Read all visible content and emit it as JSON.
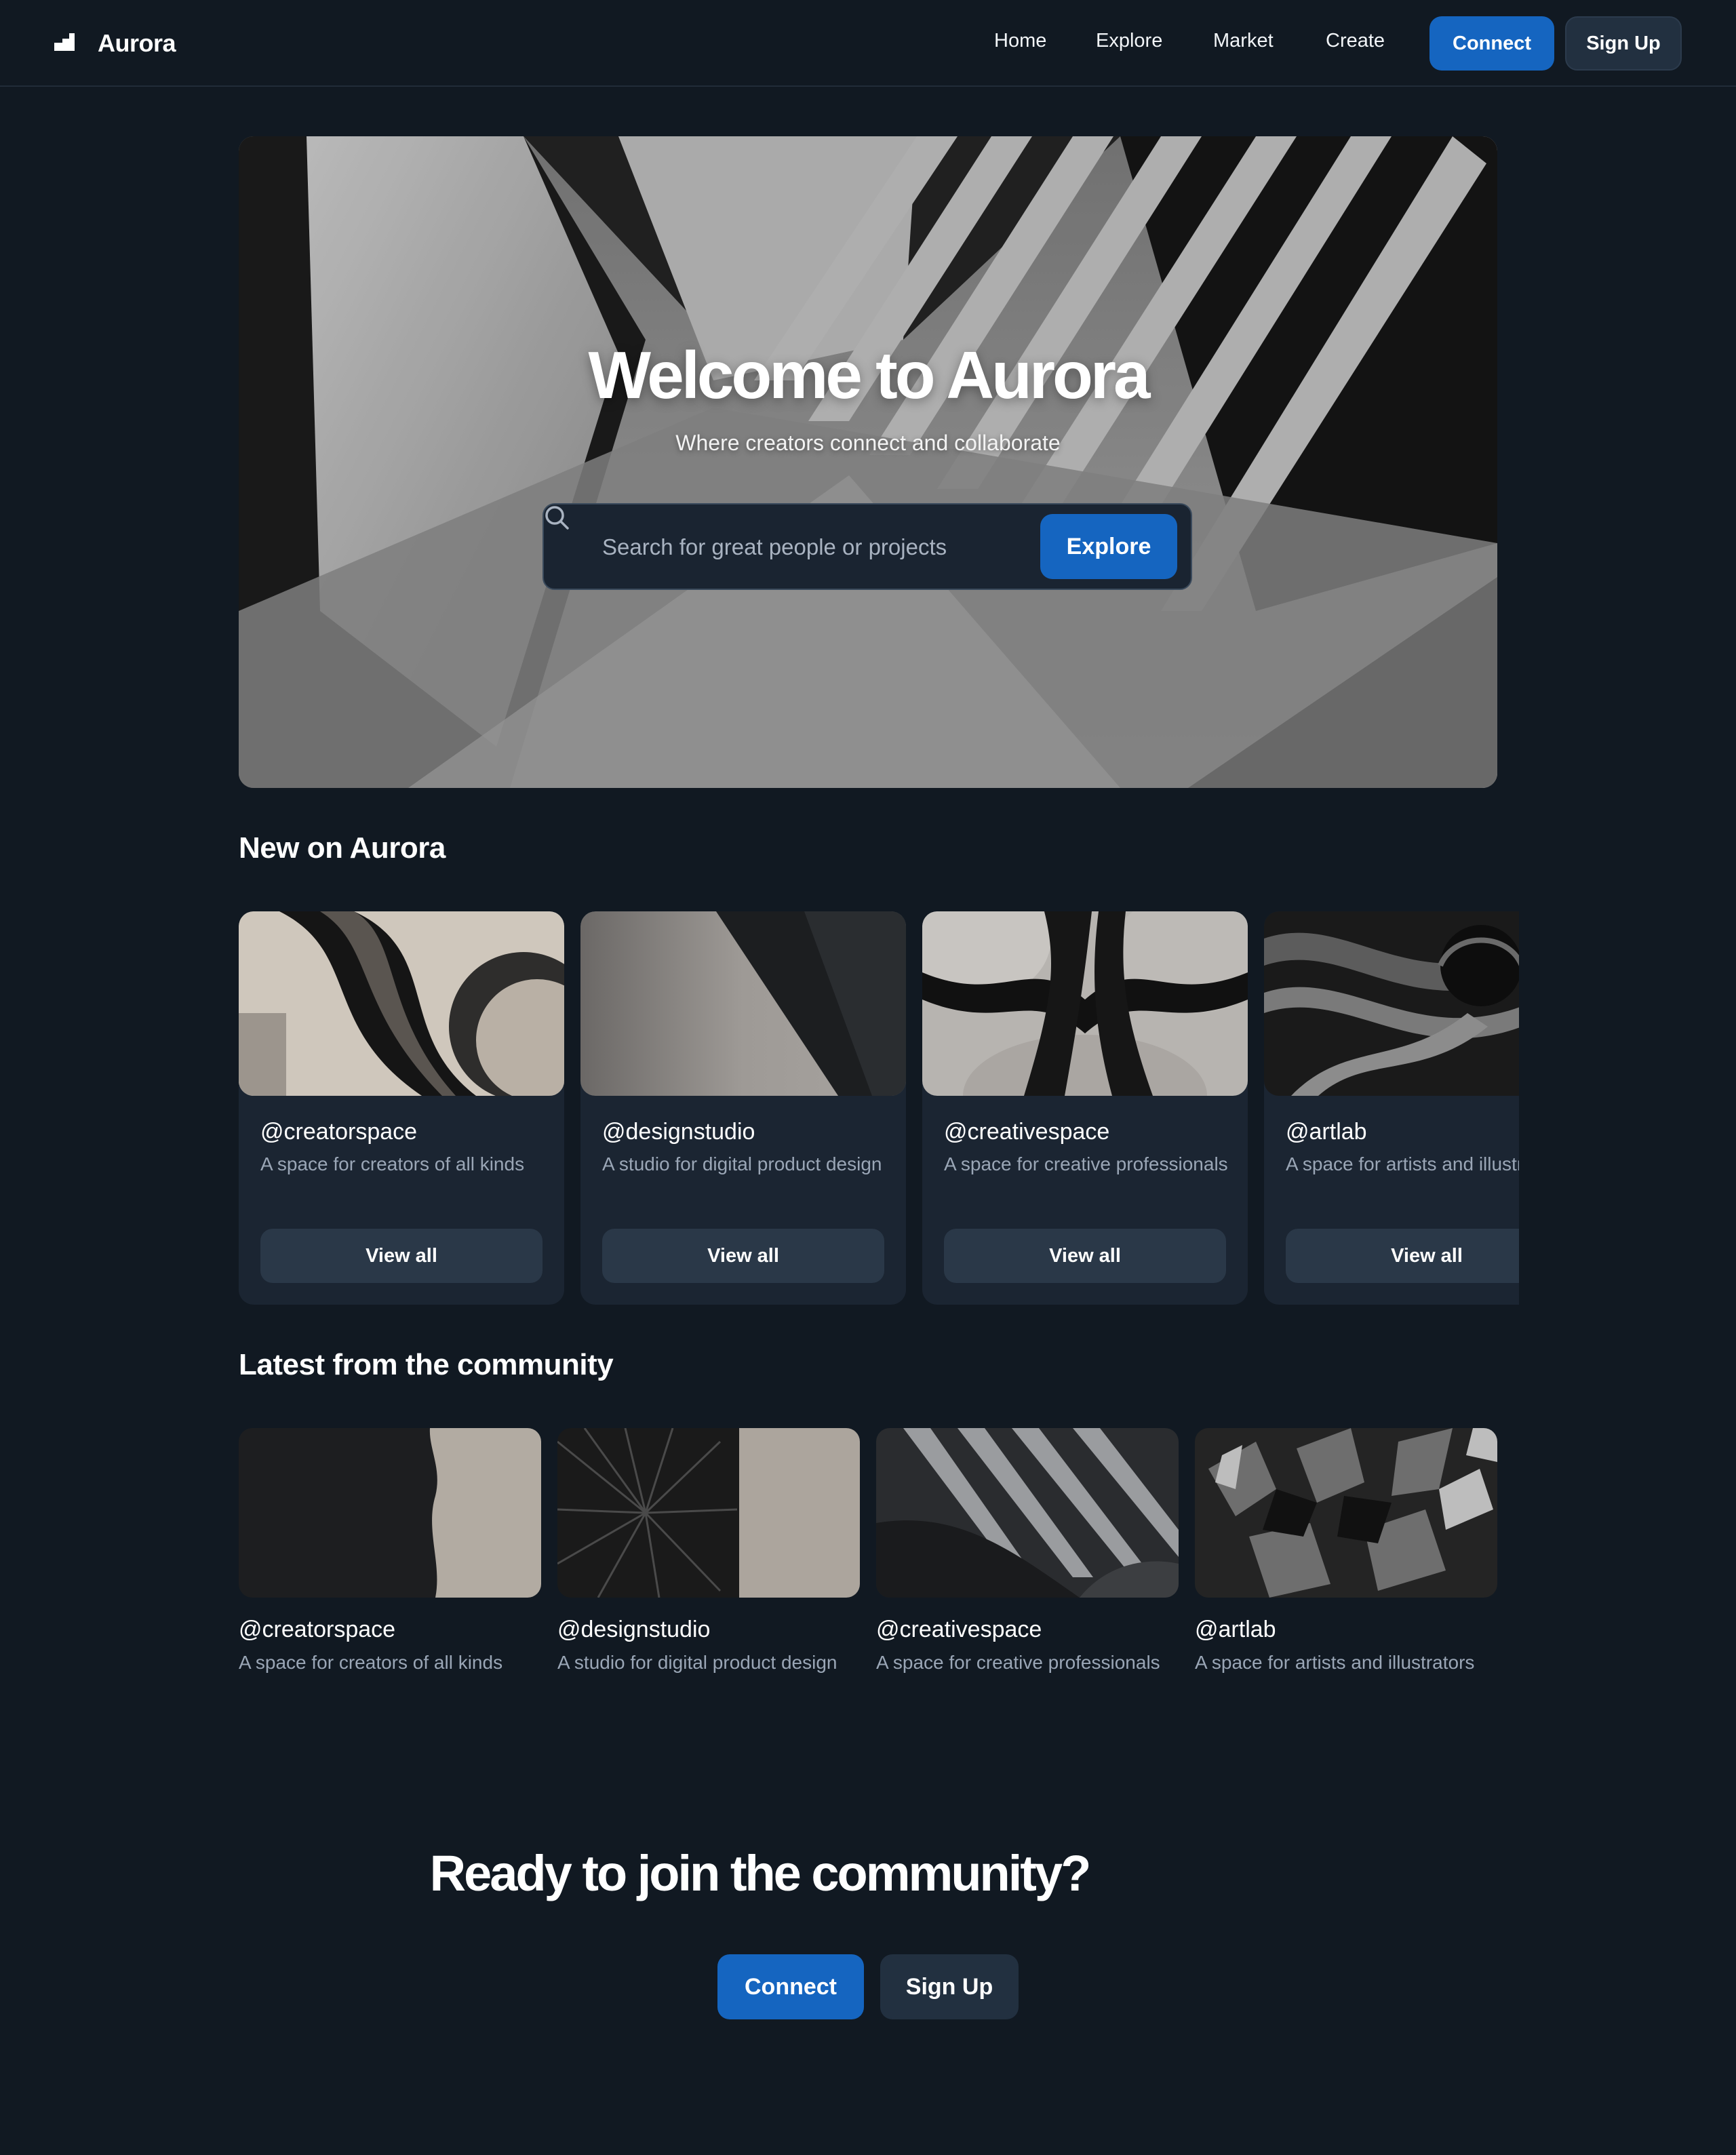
{
  "nav": {
    "brand": "Aurora",
    "links": [
      "Home",
      "Explore",
      "Market",
      "Create"
    ],
    "connect_label": "Connect",
    "signup_label": "Sign Up"
  },
  "hero": {
    "title": "Welcome to Aurora",
    "subtitle": "Where creators connect and collaborate",
    "search_placeholder": "Search for great people or projects",
    "explore_label": "Explore"
  },
  "new_section": {
    "title": "New on Aurora",
    "cards": [
      {
        "handle": "@creatorspace",
        "desc": "A space for creators of all kinds",
        "button": "View all"
      },
      {
        "handle": "@designstudio",
        "desc": "A studio for digital product design",
        "button": "View all"
      },
      {
        "handle": "@creativespace",
        "desc": "A space for creative professionals",
        "button": "View all"
      },
      {
        "handle": "@artlab",
        "desc": "A space for artists and illustrators",
        "button": "View all"
      }
    ]
  },
  "community_section": {
    "title": "Latest from the community",
    "items": [
      {
        "handle": "@creatorspace",
        "desc": "A space for creators of all kinds"
      },
      {
        "handle": "@designstudio",
        "desc": "A studio for digital product design"
      },
      {
        "handle": "@creativespace",
        "desc": "A space for creative professionals"
      },
      {
        "handle": "@artlab",
        "desc": "A space for artists and illustrators"
      }
    ]
  },
  "cta": {
    "title": "Ready to join the community?",
    "connect_label": "Connect",
    "signup_label": "Sign Up"
  },
  "colors": {
    "background": "#111922",
    "primary": "#1565c0",
    "secondary": "#223040",
    "card": "#1b2532",
    "muted_text": "#9aa6b6"
  }
}
